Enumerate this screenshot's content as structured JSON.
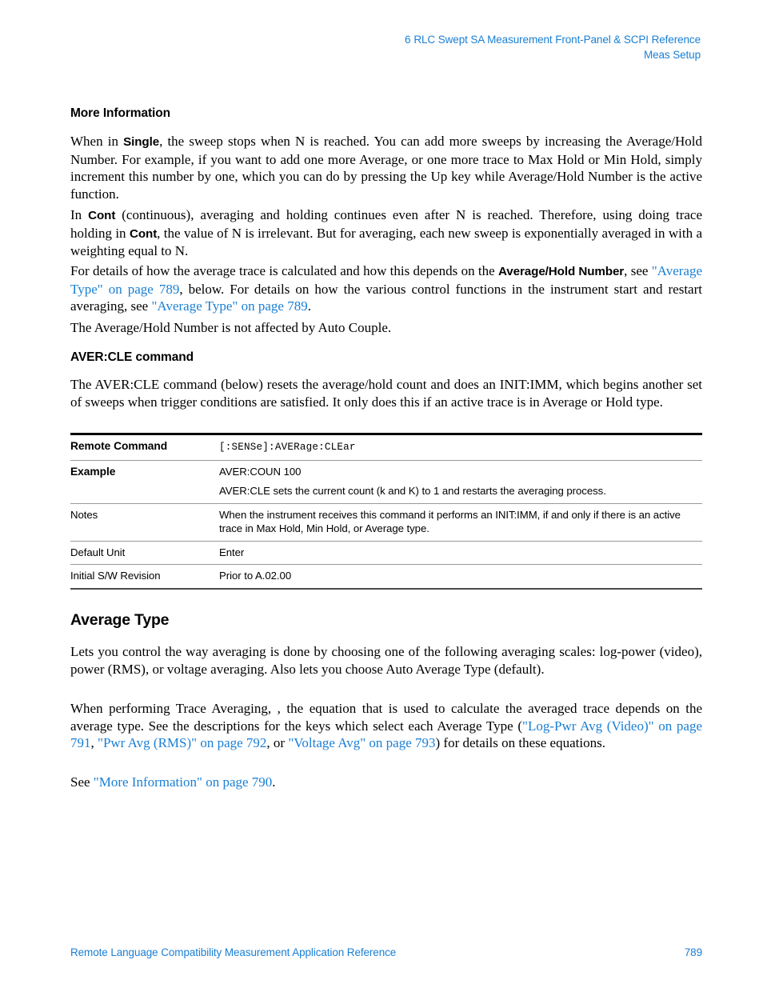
{
  "header": {
    "chapter_number": "6",
    "chapter_title": "RLC Swept SA Measurement Front-Panel & SCPI Reference",
    "section": "Meas Setup",
    "color": "#1a7fd4"
  },
  "sections": {
    "more_information": {
      "heading": "More Information",
      "p1_a": "When in ",
      "p1_b_single": "Single",
      "p1_c": ", the sweep stops when N is reached. You can add more sweeps by increasing the Average/Hold Number.   For example, if you want to add one more Average, or one more trace to Max Hold or Min Hold, simply increment this number by one, which you can do by pressing the Up key while Average/Hold Number is the active function.",
      "p2_a": "In ",
      "p2_b_cont1": "Cont",
      "p2_c": " (continuous), averaging and holding continues even after N is reached. Therefore, using doing trace holding in ",
      "p2_d_cont2": "Cont",
      "p2_e": ", the value of N is irrelevant. But for averaging, each new sweep is exponentially averaged in with a weighting equal to N.",
      "p3_a": "For details of how the average trace is calculated and how this depends on the ",
      "p3_b_bold": "Average/Hold Number",
      "p3_c": ", see ",
      "p3_link1": "\"Average Type\" on page 789",
      "p3_d": ", below. For details on how the various control functions in the instrument start and restart averaging, see ",
      "p3_link2": "\"Average Type\" on page 789",
      "p3_e": ".",
      "p4": "The Average/Hold Number is not affected by Auto Couple."
    },
    "aver_cle": {
      "heading": "AVER:CLE command",
      "p1": "The AVER:CLE command (below) resets the average/hold count and does an INIT:IMM, which begins another set of sweeps when trigger conditions are satisfied. It only does this if an active trace is in Average or Hold type."
    },
    "average_type": {
      "heading": "Average Type",
      "p1": "Lets you control the way averaging is done by choosing one of the following averaging scales: log-power (video), power (RMS), or voltage averaging. Also lets you choose Auto Average Type (default).",
      "p2_a": "When performing Trace Averaging, , the equation that is used to calculate the averaged trace depends on the average type.  See the descriptions for the keys which select each Average Type (",
      "p2_link1": "\"Log-Pwr Avg (Video)\" on page 791",
      "p2_b": ", ",
      "p2_link2": "\"Pwr Avg (RMS)\" on page 792",
      "p2_c": ", or ",
      "p2_link3": "\"Voltage Avg\" on page 793",
      "p2_d": ") for details on these equations.",
      "p3_a": "See ",
      "p3_link": "\"More Information\" on page 790",
      "p3_b": "."
    }
  },
  "parameter_table": {
    "rows": [
      {
        "label": "Remote Command",
        "value": "[:SENSe]:AVERage:CLEar",
        "value2": ""
      },
      {
        "label": "Example",
        "value": "AVER:COUN 100",
        "value2": "AVER:CLE sets the current count (k and K) to 1 and restarts the averaging process."
      },
      {
        "label": "Notes",
        "value": "When the instrument receives this command it performs an INIT:IMM, if and only if there is an active trace in Max Hold, Min Hold, or Average type.",
        "value2": ""
      },
      {
        "label": "Default Unit",
        "value": "Enter",
        "value2": ""
      },
      {
        "label": "Initial S/W Revision",
        "value": "Prior to A.02.00",
        "value2": ""
      }
    ]
  },
  "footer": {
    "title": "Remote Language Compatibility Measurement Application Reference",
    "page_number": "789"
  }
}
